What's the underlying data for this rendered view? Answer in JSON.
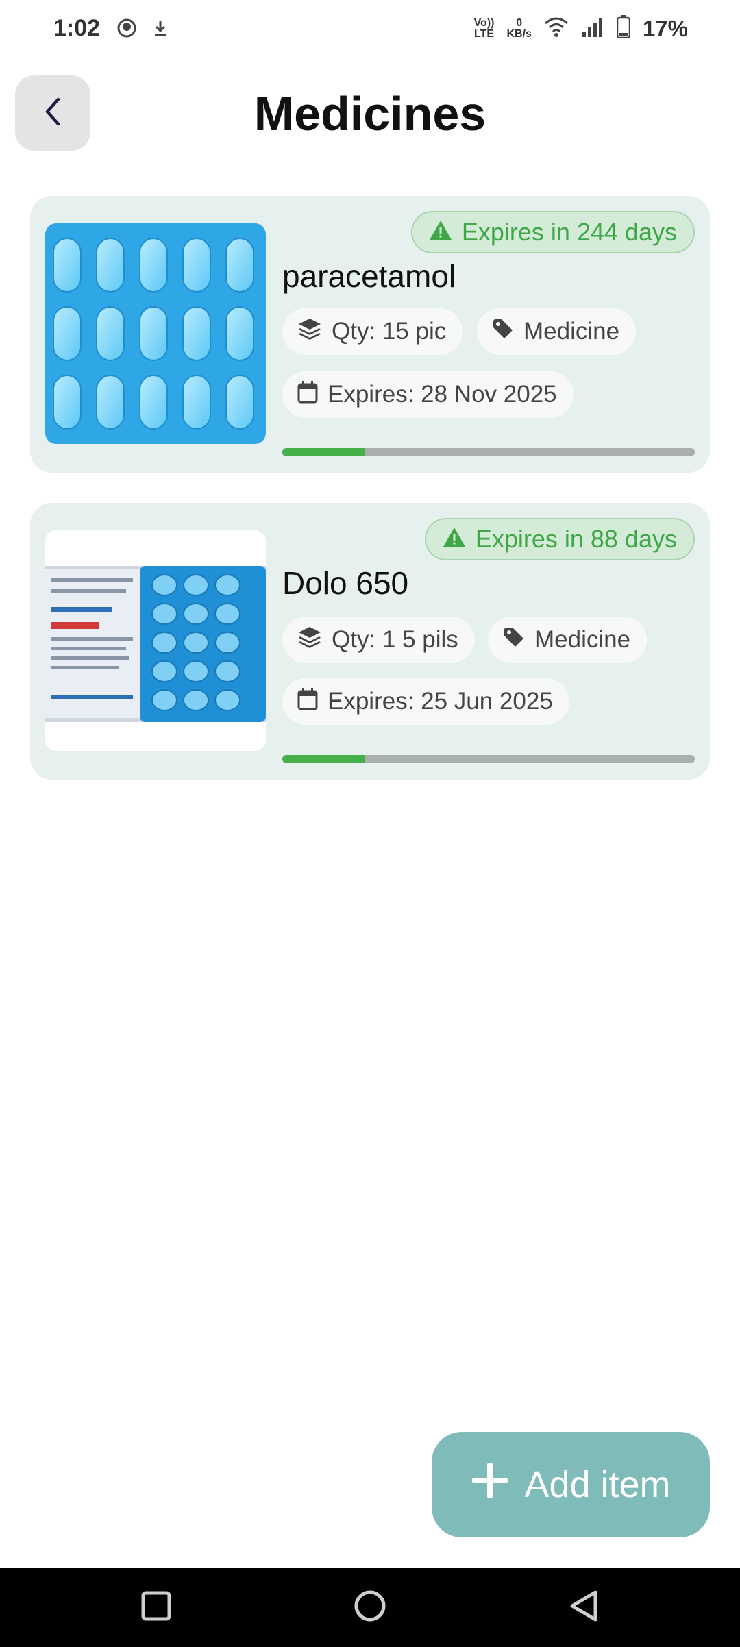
{
  "status_bar": {
    "time": "1:02",
    "net_top": "0",
    "net_bottom": "KB/s",
    "volte_top": "Vo))",
    "volte_bottom": "LTE",
    "battery": "17%"
  },
  "header": {
    "title": "Medicines",
    "back_icon": "chevron-left-icon"
  },
  "items": [
    {
      "name": "paracetamol",
      "expiry_badge": "Expires in 244 days",
      "qty": "Qty: 15 pic",
      "category": "Medicine",
      "expires": "Expires: 28 Nov 2025",
      "remaining_fraction": 0.2
    },
    {
      "name": "Dolo 650",
      "expiry_badge": "Expires in 88 days",
      "qty": "Qty: 1 5 pils",
      "category": "Medicine",
      "expires": "Expires: 25 Jun 2025",
      "remaining_fraction": 0.2
    }
  ],
  "fab": {
    "label": "Add item"
  },
  "colors": {
    "card_bg": "#e6f0ef",
    "badge_green": "#3fa748",
    "progress_green": "#45b04a",
    "fab_bg": "#7fbcb9"
  }
}
